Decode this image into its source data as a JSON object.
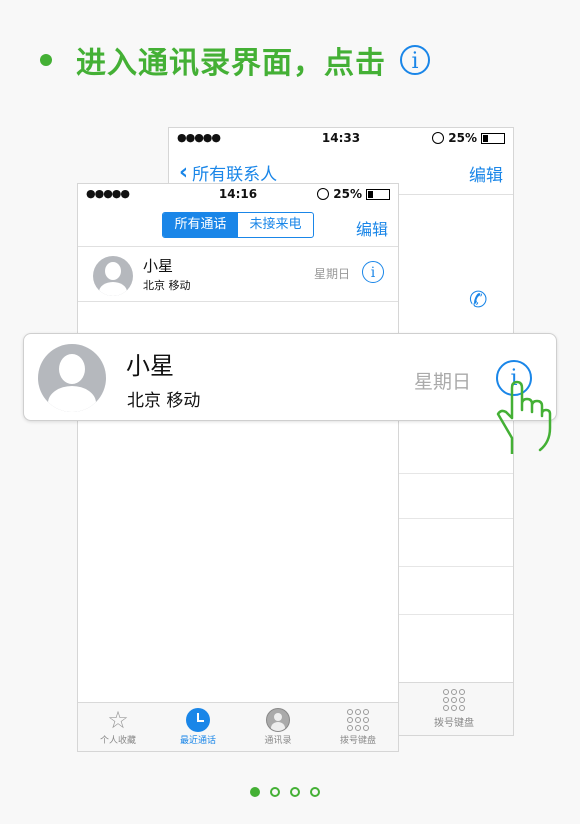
{
  "headline": {
    "text": "进入通讯录界面，点击",
    "info_glyph": "i"
  },
  "back_phone": {
    "status": {
      "signal": "●●●●●",
      "time": "14:33",
      "battery": "25%"
    },
    "nav": {
      "back_label": "所有联系人",
      "edit_label": "编辑"
    },
    "tab_dial_label": "拨号键盘"
  },
  "front_phone": {
    "status": {
      "signal": "●●●●●",
      "time": "14:16",
      "battery": "25%"
    },
    "segments": [
      "所有通话",
      "未接来电"
    ],
    "edit_label": "编辑",
    "row": {
      "name": "小星",
      "subtitle": "北京 移动",
      "day": "星期日",
      "info_glyph": "i"
    },
    "tabs": [
      {
        "label": "个人收藏",
        "icon": "star-icon"
      },
      {
        "label": "最近通话",
        "icon": "clock-icon"
      },
      {
        "label": "通讯录",
        "icon": "contacts-icon"
      },
      {
        "label": "拨号键盘",
        "icon": "keypad-icon"
      }
    ]
  },
  "zoom_row": {
    "name": "小星",
    "subtitle": "北京 移动",
    "day": "星期日",
    "info_glyph": "i"
  },
  "pager": {
    "active_index": 0,
    "count": 4
  },
  "colors": {
    "accent_green": "#44b035",
    "ios_blue": "#1a86e8"
  }
}
